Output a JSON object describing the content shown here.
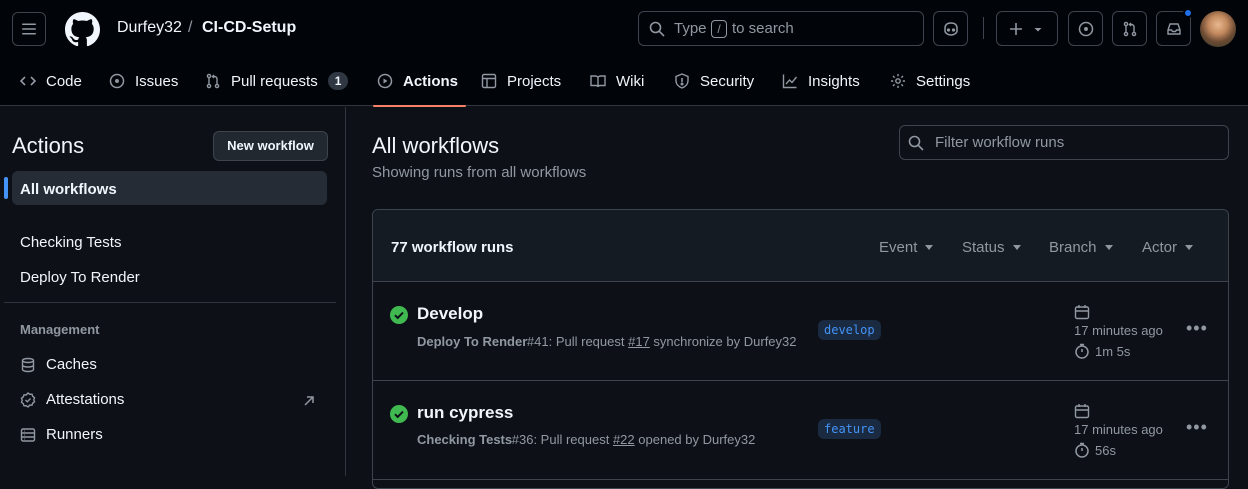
{
  "header": {
    "owner": "Durfey32",
    "separator": "/",
    "repo": "CI-CD-Setup",
    "search": {
      "prefix": "Type",
      "key": "/",
      "suffix": "to search"
    }
  },
  "tabs": [
    {
      "label": "Code"
    },
    {
      "label": "Issues"
    },
    {
      "label": "Pull requests",
      "count": "1"
    },
    {
      "label": "Actions"
    },
    {
      "label": "Projects"
    },
    {
      "label": "Wiki"
    },
    {
      "label": "Security"
    },
    {
      "label": "Insights"
    },
    {
      "label": "Settings"
    }
  ],
  "sidebar": {
    "title": "Actions",
    "new_button": "New workflow",
    "items": [
      "All workflows",
      "Checking Tests",
      "Deploy To Render"
    ],
    "management_heading": "Management",
    "management": [
      "Caches",
      "Attestations",
      "Runners"
    ]
  },
  "main": {
    "title": "All workflows",
    "subtitle": "Showing runs from all workflows",
    "filter_placeholder": "Filter workflow runs",
    "run_count": "77 workflow runs",
    "filters": [
      "Event",
      "Status",
      "Branch",
      "Actor"
    ],
    "runs": [
      {
        "title": "Develop",
        "workflow": "Deploy To Render",
        "run": "#41",
        "pre": ": Pull request ",
        "pr": "#17",
        "post": " synchronize by Durfey32",
        "branch": "develop",
        "ago": "17 minutes ago",
        "duration": "1m 5s",
        "status": "success"
      },
      {
        "title": "run cypress",
        "workflow": "Checking Tests",
        "run": "#36",
        "pre": ": Pull request ",
        "pr": "#22",
        "post": " opened by Durfey32",
        "branch": "feature",
        "ago": "17 minutes ago",
        "duration": "56s",
        "status": "success"
      }
    ]
  },
  "colors": {
    "accent": "#f78166",
    "link": "#4493f8",
    "success": "#3fb950"
  }
}
